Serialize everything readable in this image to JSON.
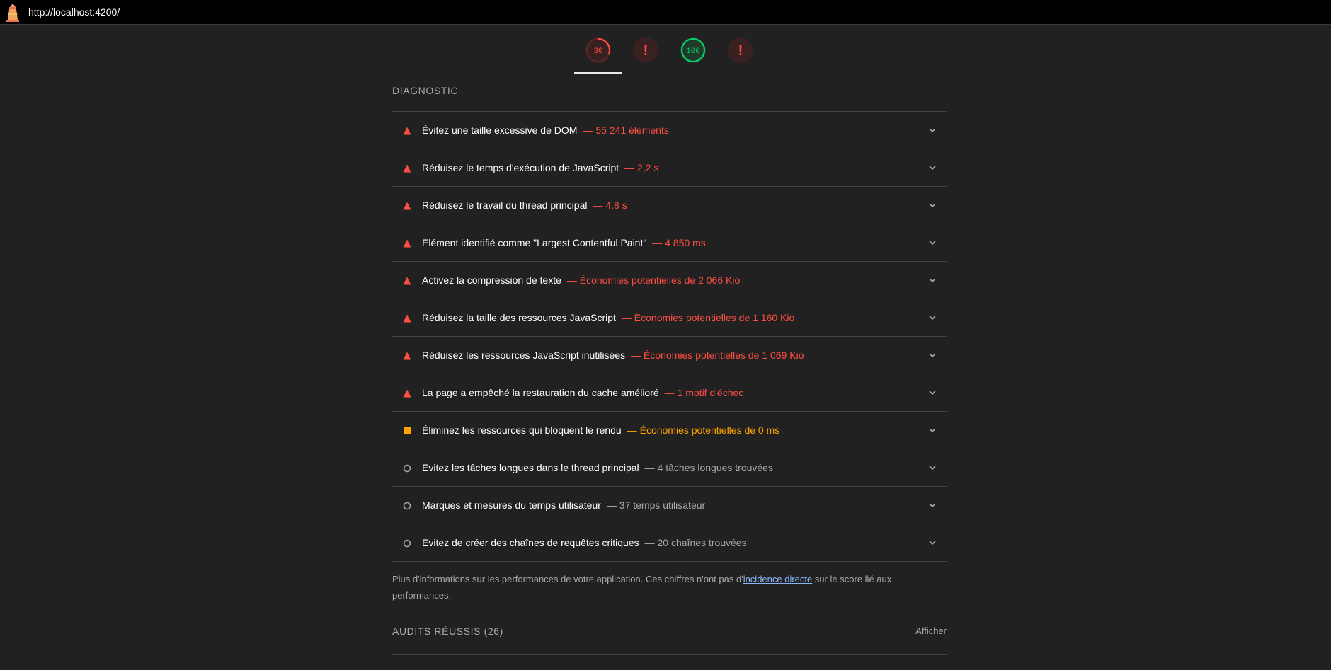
{
  "topbar": {
    "url": "http://localhost:4200/",
    "logo_icon": "lighthouse-icon"
  },
  "gauges": [
    {
      "name": "performance",
      "label": "30",
      "rating": "fail",
      "score": 30
    },
    {
      "name": "accessibility",
      "label": "!",
      "rating": "error"
    },
    {
      "name": "best-practices",
      "label": "100",
      "rating": "pass",
      "score": 100
    },
    {
      "name": "seo",
      "label": "!",
      "rating": "error"
    }
  ],
  "colors": {
    "fail": "#ff4e42",
    "average": "#ffa400",
    "pass": "#0cce6b",
    "info": "#a9a9a9",
    "link": "#8ab4f8"
  },
  "diagnostic": {
    "title": "DIAGNOSTIC",
    "audits": [
      {
        "title": "Évitez une taille excessive de DOM",
        "detail": "— 55 241 éléments",
        "status": "fail"
      },
      {
        "title": "Réduisez le temps d'exécution de JavaScript",
        "detail": "— 2,2 s",
        "status": "fail"
      },
      {
        "title": "Réduisez le travail du thread principal",
        "detail": "— 4,8 s",
        "status": "fail"
      },
      {
        "title": "Élément identifié comme \"Largest Contentful Paint\"",
        "detail": "— 4 850 ms",
        "status": "fail"
      },
      {
        "title": "Activez la compression de texte",
        "detail": "— Économies potentielles de 2 066 Kio",
        "status": "fail"
      },
      {
        "title": "Réduisez la taille des ressources JavaScript",
        "detail": "— Économies potentielles de 1 160 Kio",
        "status": "fail"
      },
      {
        "title": "Réduisez les ressources JavaScript inutilisées",
        "detail": "— Économies potentielles de 1 069 Kio",
        "status": "fail"
      },
      {
        "title": "La page a empêché la restauration du cache amélioré",
        "detail": "— 1 motif d'échec",
        "status": "fail"
      },
      {
        "title": "Éliminez les ressources qui bloquent le rendu",
        "detail": "— Économies potentielles de 0 ms",
        "status": "average"
      },
      {
        "title": "Évitez les tâches longues dans le thread principal",
        "detail": "— 4 tâches longues trouvées",
        "status": "info"
      },
      {
        "title": "Marques et mesures du temps utilisateur",
        "detail": "— 37 temps utilisateur",
        "status": "info"
      },
      {
        "title": "Évitez de créer des chaînes de requêtes critiques",
        "detail": "— 20 chaînes trouvées",
        "status": "info"
      }
    ],
    "description_before": "Plus d'informations sur les performances de votre application. Ces chiffres n'ont pas d'",
    "description_link": "incidence directe",
    "description_after": " sur le score lié aux performances."
  },
  "passed": {
    "title": "AUDITS RÉUSSIS (26)",
    "show_label": "Afficher"
  }
}
